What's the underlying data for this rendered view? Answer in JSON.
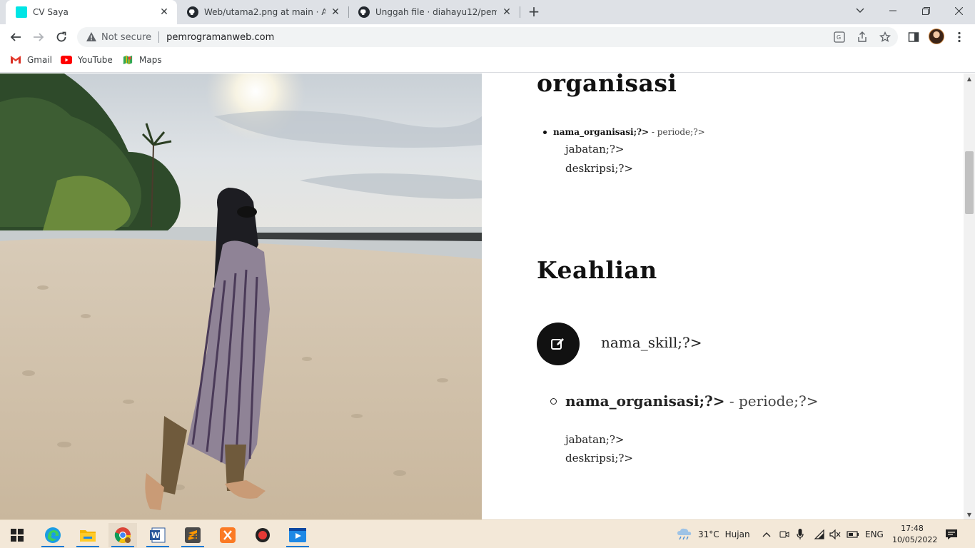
{
  "browser": {
    "tabs": [
      {
        "title": "CV Saya",
        "active": true,
        "favicon": "cyan-square-icon"
      },
      {
        "title": "Web/utama2.png at main · Apria",
        "active": false,
        "favicon": "github-icon"
      },
      {
        "title": "Unggah file · diahayu12/pemogra",
        "active": false,
        "favicon": "github-icon"
      }
    ],
    "new_tab_label": "+",
    "address": {
      "security_label": "Not secure",
      "url": "pemrogramanweb.com"
    },
    "bookmarks": [
      {
        "label": "Gmail",
        "icon": "gmail-icon"
      },
      {
        "label": "YouTube",
        "icon": "youtube-icon"
      },
      {
        "label": "Maps",
        "icon": "maps-icon"
      }
    ]
  },
  "page": {
    "organisasi_heading": "organisasi",
    "org_small": {
      "name": "nama_organisasi;?>",
      "period": " - periode;?>",
      "jabatan": "jabatan;?>",
      "deskripsi": "deskripsi;?>"
    },
    "keahlian_heading": "Keahlian",
    "skill": {
      "name": "nama_skill;?>",
      "icon": "edit-icon"
    },
    "org_big": {
      "name": "nama_organisasi;?>",
      "period": " - periode;?>",
      "jabatan": "jabatan;?>",
      "deskripsi": "deskripsi;?>"
    }
  },
  "taskbar": {
    "apps": [
      "windows-start-icon",
      "edge-icon",
      "file-explorer-icon",
      "chrome-icon",
      "word-icon",
      "sublime-text-icon",
      "xampp-icon",
      "record-icon",
      "media-player-icon"
    ],
    "weather": {
      "temp": "31°C",
      "condition": "Hujan"
    },
    "language": "ENG",
    "time": "17:48",
    "date": "10/05/2022"
  },
  "colors": {
    "tabstrip_bg": "#dee1e6",
    "taskbar_bg": "#f3e8d8",
    "accent": "#0078d4",
    "skill_circle": "#111111"
  }
}
